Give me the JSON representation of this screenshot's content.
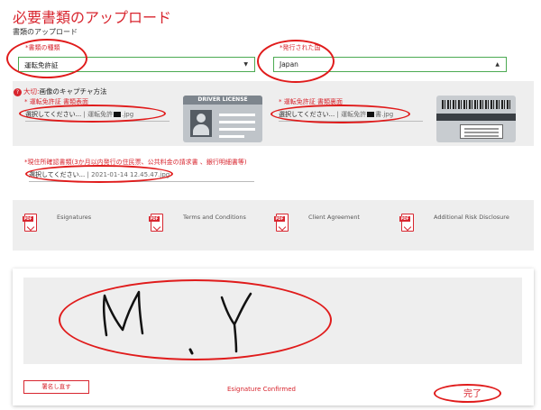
{
  "page": {
    "title": "必要書類のアップロード",
    "subtitle": "書類のアップロード"
  },
  "selects": {
    "doc_type": {
      "label": "*書類の種類",
      "value": "運転免許証"
    },
    "issuer": {
      "label": "*発行された国",
      "value": "Japan"
    }
  },
  "important": {
    "badge": "?",
    "strong": "大切:",
    "text": "画像のキャプチャ方法"
  },
  "uploads": {
    "front": {
      "label": "* 運転免許証 書類表面",
      "button": "選択してください...",
      "file_prefix": "運転免許",
      "file_ext": ".jpg"
    },
    "back": {
      "label": "* 運転免許証 書類裏面",
      "button": "選択してください...",
      "file_prefix": "運転免許",
      "file_mid": "書",
      "file_ext": ".jpg"
    },
    "address": {
      "label": "*現住所確認書類(3か月以内発行の住民票、公共料金の請求書 、銀行明細書等)",
      "button": "選択してください...",
      "file": "2021-01-14 12.45.47.jpg"
    }
  },
  "card_images": {
    "front_caption": "DRIVER LICENSE"
  },
  "documents": [
    {
      "icon": "pdf-icon",
      "pdf_tag": "PDF",
      "label": "Esignatures"
    },
    {
      "icon": "pdf-icon",
      "pdf_tag": "PDF",
      "label": "Terms and Conditions"
    },
    {
      "icon": "pdf-icon",
      "pdf_tag": "PDF",
      "label": "Client Agreement"
    },
    {
      "icon": "pdf-icon",
      "pdf_tag": "PDF",
      "label": "Additional Risk Disclosure"
    }
  ],
  "signature": {
    "drawn_text": "M.Y",
    "resign_button": "署名し直す",
    "status": "Esignature Confirmed",
    "done": "完了"
  },
  "colors": {
    "accent": "#d8262f",
    "select_border": "#4caa52",
    "annotation": "#e01b1b",
    "panel": "#eeeeee"
  }
}
